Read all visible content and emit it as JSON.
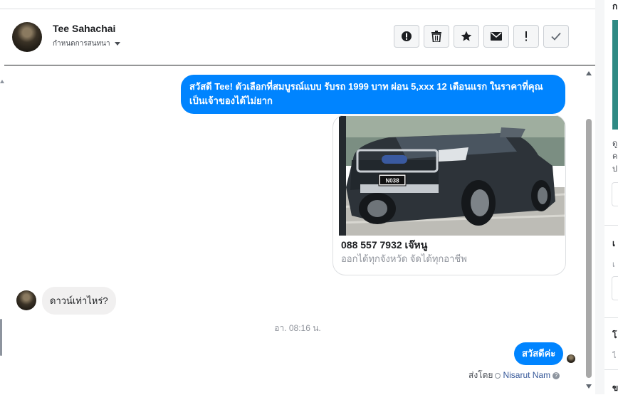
{
  "header": {
    "contact_name": "Tee Sahachai",
    "assign_label": "กำหนดการสนทนา",
    "actions": [
      "spam-icon",
      "trash-icon",
      "star-icon",
      "envelope-icon",
      "exclamation-icon",
      "check-icon"
    ]
  },
  "conversation": {
    "outgoing_text": "สวัสดี Tee! ตัวเลือกที่สมบูรณ์แบบ รับรถ 1999 บาท ผ่อน 5,xxx 12 เดือนแรก ในราคาที่คุณเป็นเจ้าของได้ไม่ยาก",
    "card": {
      "plate": "N038",
      "title": "088 557 7932 เจ๊หนู",
      "subtitle": "ออกได้ทุกจังหวัด จัดได้ทุกอาชีพ"
    },
    "incoming_text": "ดาวน์เท่าไหร่?",
    "timestamp": "อา. 08:16 น.",
    "reply_text": "สวัสดีค่ะ",
    "sent_by_label": "ส่งโดย",
    "agent_name": "Nisarut Nam",
    "help_glyph": "?"
  },
  "right_panel": {
    "header": "ก",
    "lines": [
      "ดู",
      "ค",
      "ป"
    ],
    "section2_title": "เ",
    "section2_sub": "เ",
    "section3_title": "โ",
    "section3_sub": "ไ",
    "section4_title": "ข"
  },
  "colors": {
    "accent": "#0084ff",
    "teal": "#2f8a84",
    "incoming_bubble": "#f1f0f0"
  }
}
